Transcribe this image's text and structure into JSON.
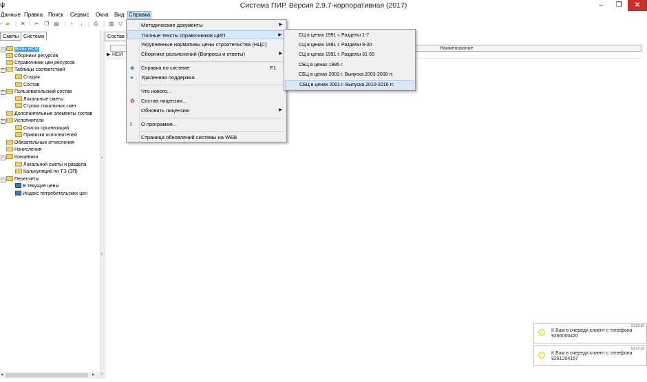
{
  "window": {
    "title": "Система ПИР. Версия 2.9.7-корпоративная (2017)",
    "min": "–",
    "max": "❐",
    "close": "✕"
  },
  "menubar": [
    "Данные",
    "Правка",
    "Поиск",
    "Сервис",
    "Окна",
    "Вид",
    "Справка"
  ],
  "left_tabs": [
    "Сметы",
    "Система"
  ],
  "tree": [
    {
      "label": "Базы НСИ",
      "icon": "folder",
      "level": 0,
      "expander": "-",
      "selected": true
    },
    {
      "label": "Сборники ресурсов",
      "icon": "folder",
      "level": 0,
      "expander": ""
    },
    {
      "label": "Справочники цен ресурсов",
      "icon": "folder",
      "level": 0,
      "expander": ""
    },
    {
      "label": "Таблицы соответствий",
      "icon": "folder",
      "level": 0,
      "expander": "-"
    },
    {
      "label": "Стадия",
      "icon": "folder",
      "level": 1,
      "expander": ""
    },
    {
      "label": "Состав",
      "icon": "folder",
      "level": 1,
      "expander": ""
    },
    {
      "label": "Пользовательский состав",
      "icon": "folder",
      "level": 0,
      "expander": "-"
    },
    {
      "label": "Локальные сметы",
      "icon": "folder",
      "level": 1,
      "expander": ""
    },
    {
      "label": "Строки локальных смет",
      "icon": "folder",
      "level": 1,
      "expander": ""
    },
    {
      "label": "Дополнительные элементы состав",
      "icon": "folder",
      "level": 0,
      "expander": ""
    },
    {
      "label": "Исполнители",
      "icon": "folder",
      "level": 0,
      "expander": "-"
    },
    {
      "label": "Список организаций",
      "icon": "folder",
      "level": 1,
      "expander": ""
    },
    {
      "label": "Привязки исполнителей",
      "icon": "folder",
      "level": 1,
      "expander": ""
    },
    {
      "label": "Обязательные отчисления",
      "icon": "folder",
      "level": 0,
      "expander": ""
    },
    {
      "label": "Начисления",
      "icon": "folder",
      "level": 0,
      "expander": ""
    },
    {
      "label": "Концевики",
      "icon": "folder",
      "level": 0,
      "expander": "-"
    },
    {
      "label": "Локальной сметы и раздела",
      "icon": "folder",
      "level": 1,
      "expander": ""
    },
    {
      "label": "Калькуляций по Т.3 (ЗП)",
      "icon": "folder",
      "level": 1,
      "expander": ""
    },
    {
      "label": "Пересчеты",
      "icon": "folder",
      "level": 0,
      "expander": "-"
    },
    {
      "label": "В текущие цены",
      "icon": "grid",
      "level": 1,
      "expander": ""
    },
    {
      "label": "Индекс потребительских цен",
      "icon": "grid",
      "level": 1,
      "expander": ""
    }
  ],
  "right_tab": "Состав",
  "grid": {
    "header_col": "Наименование",
    "row_indicator": "▶",
    "row_cell": "НСИ"
  },
  "help_menu": {
    "items": [
      {
        "label": "Методические документы",
        "icon": "",
        "submenu": true
      },
      {
        "label": "Полные тексты справочников ЦИП",
        "icon": "",
        "submenu": true,
        "hover": true
      },
      {
        "label": "Укрупненные нормативы цены строительства (НЦС)",
        "icon": "",
        "submenu": false
      },
      {
        "label": "Сборники разъяснений (Вопросы и ответы)",
        "icon": "",
        "submenu": true
      },
      {
        "label": "Справка по системе",
        "icon": "help-book",
        "shortcut": "F1"
      },
      {
        "label": "Удаленная поддержка",
        "icon": "skype"
      },
      {
        "label": "Что нового...",
        "icon": ""
      },
      {
        "label": "Состав лицензии...",
        "icon": "award"
      },
      {
        "label": "Обновить лицензию",
        "icon": "",
        "submenu": true
      },
      {
        "label": "О программе...",
        "icon": "info"
      },
      {
        "label": "Страница обновлений системы  на WEB",
        "icon": ""
      }
    ]
  },
  "submenu": [
    {
      "label": "СЦ в ценах 1991 г. Разделы 1-7"
    },
    {
      "label": "СЦ в ценах 1991 г. Разделы 9-30"
    },
    {
      "label": "СЦ в ценах 1991 г. Разделы 31-65"
    },
    {
      "label": "СБЦ в ценах 1995 г."
    },
    {
      "label": "СБЦ в ценах 2001 г. Выпуска 2003-2008 гг."
    },
    {
      "label": "СБЦ в ценах 2001 г. Выпуска 2010-2016 гг.",
      "hover": true
    }
  ],
  "notifications": [
    {
      "time": "13:29:30",
      "line1": "К Вам в очереди клиент с телефона",
      "line2": "9266000420"
    },
    {
      "time": "13:17:10",
      "line1": "К Вам в очереди клиент с телефона",
      "line2": "9261204157"
    }
  ],
  "colors": {
    "selection": "#3399ff",
    "menu_hover": "#d9e7f6",
    "close": "#c7302b"
  }
}
